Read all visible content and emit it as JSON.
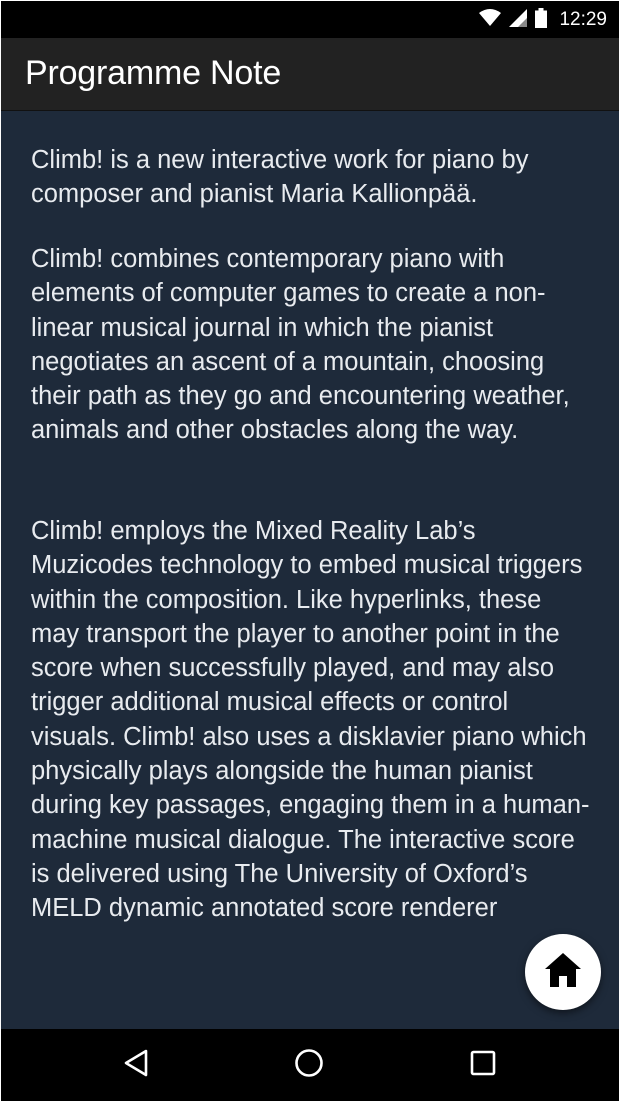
{
  "status_bar": {
    "time": "12:29",
    "icons": [
      "wifi-icon",
      "cell-signal-icon",
      "battery-icon"
    ]
  },
  "app_bar": {
    "title": "Programme Note"
  },
  "content": {
    "paragraphs": [
      "Climb! is a new interactive work for piano by composer and pianist Maria Kallionpää.",
      "Climb! combines contemporary piano with elements of computer games to create a non-linear musical journal in which the pianist negotiates an ascent of a mountain, choosing their path as they go and encountering weather, animals and other obstacles along the way.",
      "Climb! employs the Mixed Reality Lab’s Muzicodes technology to embed musical triggers within the composition. Like hyperlinks, these may transport the player to another point in the score when successfully played, and may also trigger additional musical effects or control visuals. Climb! also uses a disklavier piano which physically plays alongside the human pianist during key passages, engaging them in a human-machine musical dialogue. The interactive score is delivered using The University of Oxford’s MELD dynamic annotated score renderer"
    ]
  },
  "fab": {
    "icon": "home-icon"
  },
  "nav_bar": {
    "buttons": [
      "back-icon",
      "home-circle-icon",
      "recents-icon"
    ]
  },
  "colors": {
    "content_background": "#1e2a3a",
    "app_bar": "#222222",
    "text": "#e8ebef",
    "status_bar": "#000000"
  }
}
